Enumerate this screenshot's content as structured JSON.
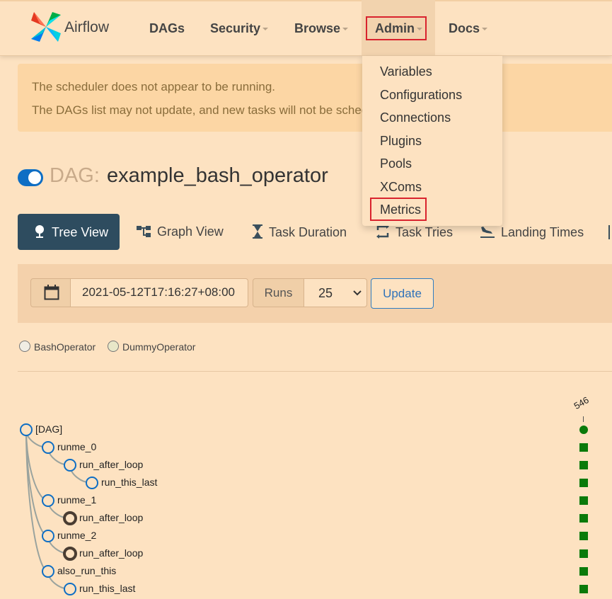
{
  "brand": {
    "name": "Airflow"
  },
  "nav": {
    "items": [
      {
        "label": "DAGs",
        "has_caret": false
      },
      {
        "label": "Security",
        "has_caret": true
      },
      {
        "label": "Browse",
        "has_caret": true
      },
      {
        "label": "Admin",
        "has_caret": true
      },
      {
        "label": "Docs",
        "has_caret": true
      }
    ]
  },
  "admin_menu": {
    "items": [
      "Variables",
      "Configurations",
      "Connections",
      "Plugins",
      "Pools",
      "XComs",
      "Metrics"
    ]
  },
  "alert": {
    "line1": "The scheduler does not appear to be running.",
    "line2": "The DAGs list may not update, and new tasks will not be scheduled."
  },
  "dag": {
    "prefix": "DAG:",
    "name": "example_bash_operator"
  },
  "tabs": [
    "Tree View",
    "Graph View",
    "Task Duration",
    "Task Tries",
    "Landing Times"
  ],
  "form": {
    "date_value": "2021-05-12T17:16:27+08:00",
    "runs_label": "Runs",
    "runs_value": "25",
    "update_label": "Update"
  },
  "legend": {
    "items": [
      {
        "label": "BashOperator",
        "color": "#f0ede4"
      },
      {
        "label": "DummyOperator",
        "color": "#e8e7c8"
      }
    ]
  },
  "tree": {
    "run_label": "546",
    "nodes": [
      {
        "label": "[DAG]",
        "depth": 0,
        "filled": false
      },
      {
        "label": "runme_0",
        "depth": 1,
        "filled": false
      },
      {
        "label": "run_after_loop",
        "depth": 2,
        "filled": false
      },
      {
        "label": "run_this_last",
        "depth": 3,
        "filled": false
      },
      {
        "label": "runme_1",
        "depth": 1,
        "filled": false
      },
      {
        "label": "run_after_loop",
        "depth": 2,
        "filled": true
      },
      {
        "label": "runme_2",
        "depth": 1,
        "filled": false
      },
      {
        "label": "run_after_loop",
        "depth": 2,
        "filled": true
      },
      {
        "label": "also_run_this",
        "depth": 1,
        "filled": false
      },
      {
        "label": "run_this_last",
        "depth": 2,
        "filled": false
      }
    ]
  },
  "colors": {
    "accent_blue": "#0e6ec4",
    "success_green": "#0a7a0a",
    "highlight_red": "#d9232e",
    "tab_active": "#2e4c5f"
  }
}
